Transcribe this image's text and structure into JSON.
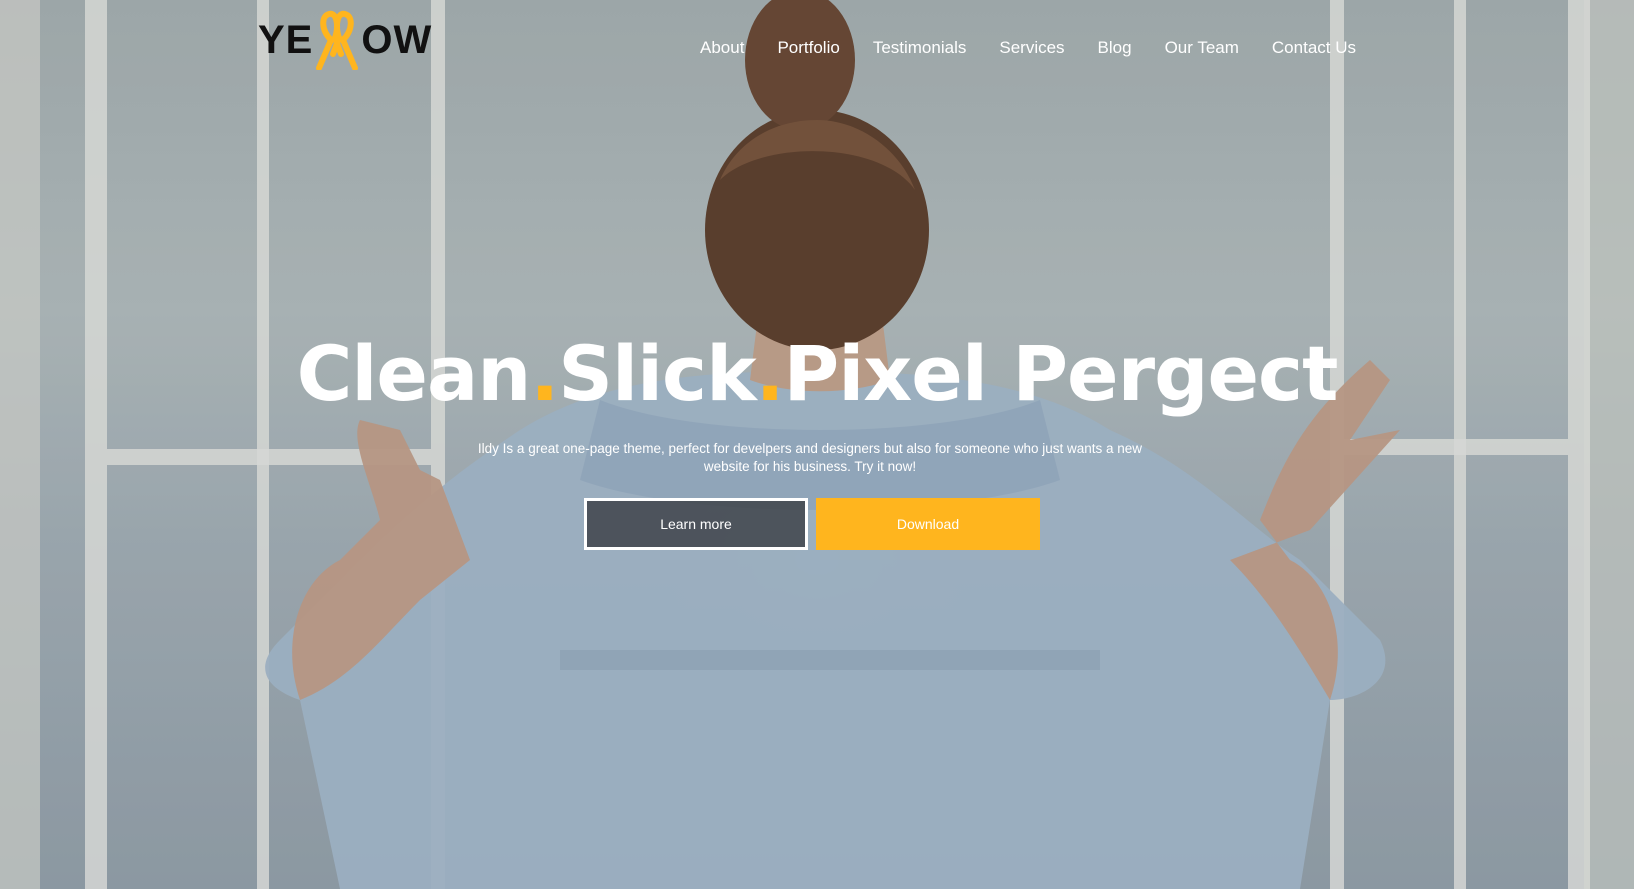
{
  "brand": {
    "logo_text_left": "YE",
    "logo_text_right": "OW",
    "logo_mark_icon": "double-loop-ribbon-icon"
  },
  "colors": {
    "accent": "#ffb51e",
    "button_dark": "#3c4046",
    "text_light": "#ffffff",
    "logo_text": "#111111"
  },
  "nav": {
    "items": [
      {
        "label": "About"
      },
      {
        "label": "Portfolio"
      },
      {
        "label": "Testimonials"
      },
      {
        "label": "Services"
      },
      {
        "label": "Blog"
      },
      {
        "label": "Our Team"
      },
      {
        "label": "Contact Us"
      }
    ]
  },
  "hero": {
    "headline": {
      "word1": "Clean",
      "sep1": ".",
      "word2": "Slick",
      "sep2": ".",
      "word3": "Pixel Pergect"
    },
    "subtext_line1": "Ildy Is a great one-page theme, perfect for develpers and designers but also for someone who just wants a new",
    "subtext_line2": "website for his business. Try it now!",
    "buttons": {
      "learn_more": "Learn more",
      "download": "Download"
    }
  }
}
